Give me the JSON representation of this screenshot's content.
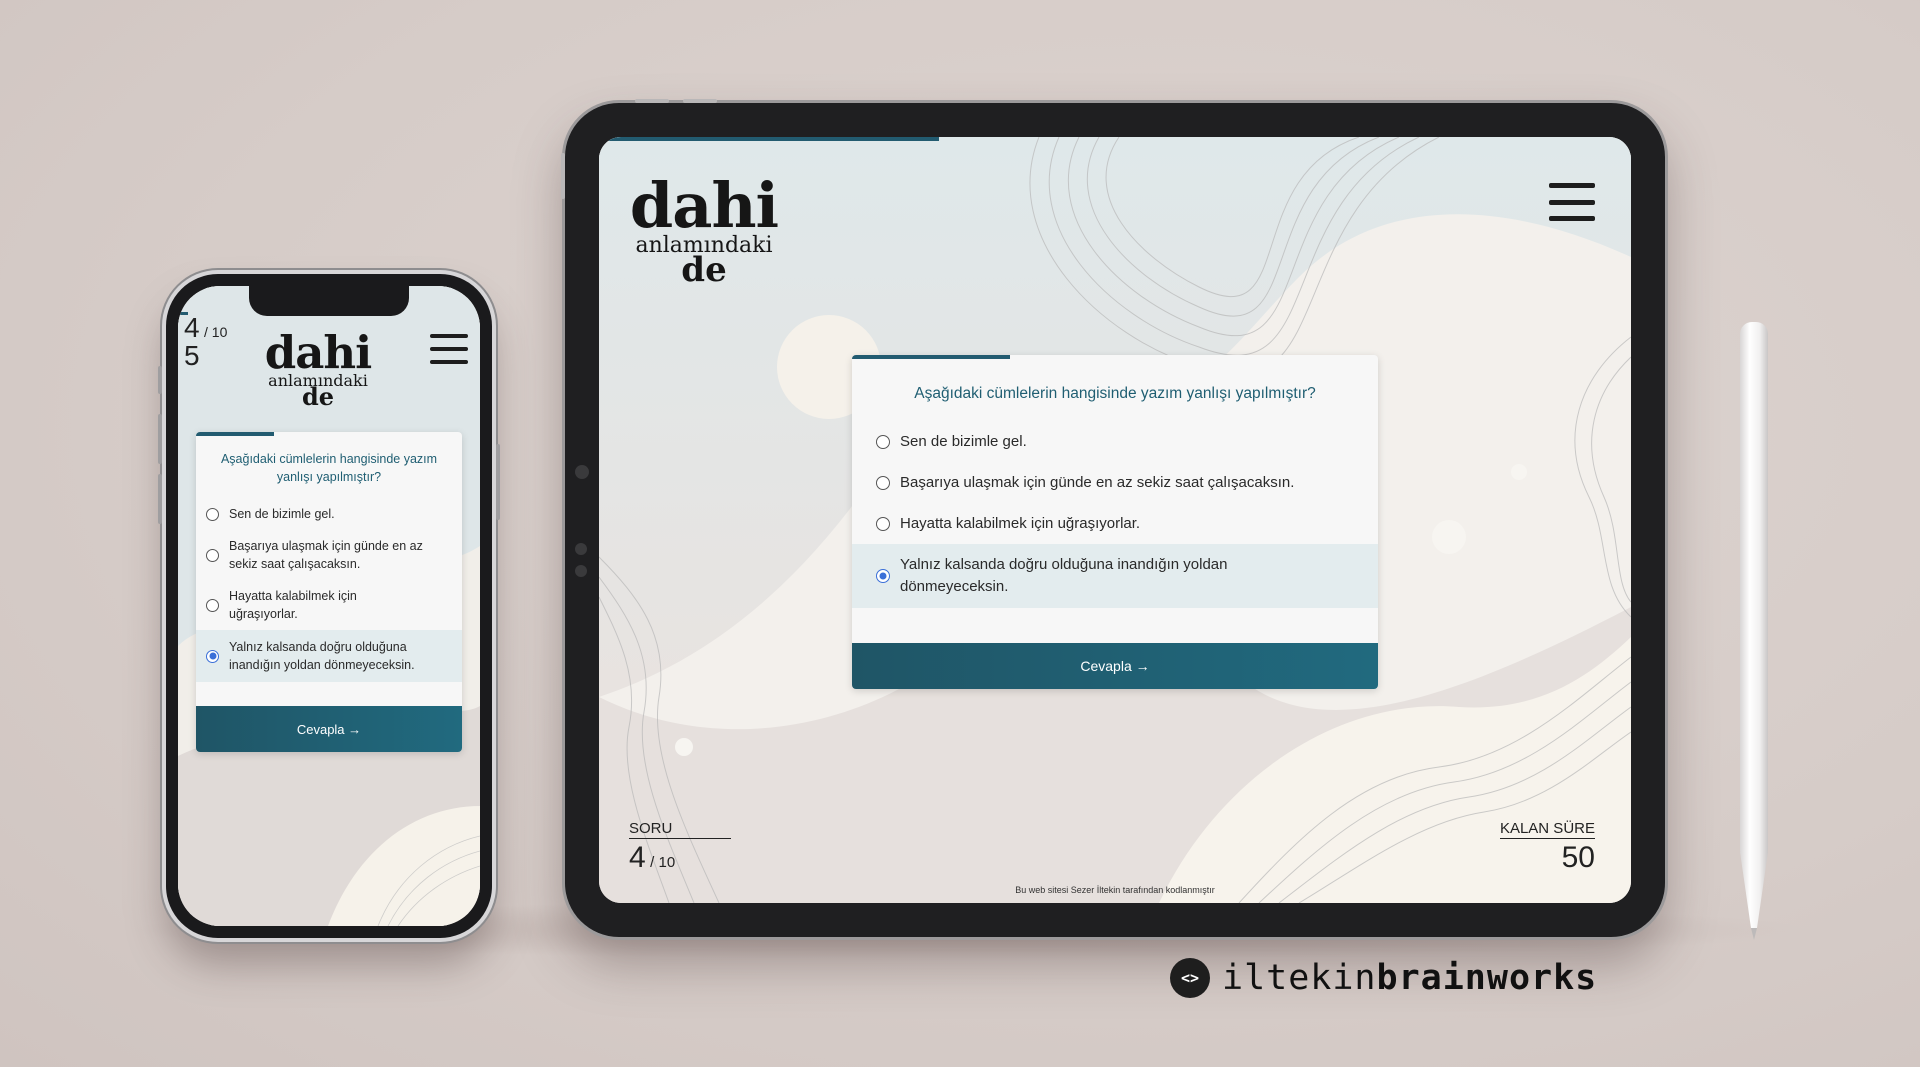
{
  "app": {
    "logo": {
      "line1": "dahi",
      "line2": "anlamındaki",
      "line3": "de"
    },
    "question": "Aşağıdaki cümlelerin hangisinde yazım yanlışı yapılmıştır?",
    "options": [
      {
        "label": "Sen de bizimle gel.",
        "selected": false
      },
      {
        "label": "Başarıya ulaşmak için günde en az sekiz saat çalışacaksın.",
        "selected": false
      },
      {
        "label": "Hayatta kalabilmek için uğraşıyorlar.",
        "selected": false
      },
      {
        "label": "Yalnız kalsanda doğru olduğuna inandığın yoldan dönmeyeceksin.",
        "selected": true
      }
    ],
    "submit_label": "Cevapla →",
    "question_label": "SORU",
    "current_question": "4",
    "total_questions": "/ 10",
    "time_label": "KALAN SÜRE",
    "time_remaining": "50",
    "phone_time_remaining": "5",
    "footer": "Bu web sitesi Sezer İltekin tarafından kodlanmıştır",
    "progress": 0.3,
    "colors": {
      "accent": "#225b70",
      "button": "#216a7f",
      "radio": "#3a6fd8"
    }
  },
  "brand": {
    "icon": "code-brackets-icon",
    "icon_glyph": "<>",
    "name_light": "iltekin",
    "name_bold": "brainworks"
  }
}
